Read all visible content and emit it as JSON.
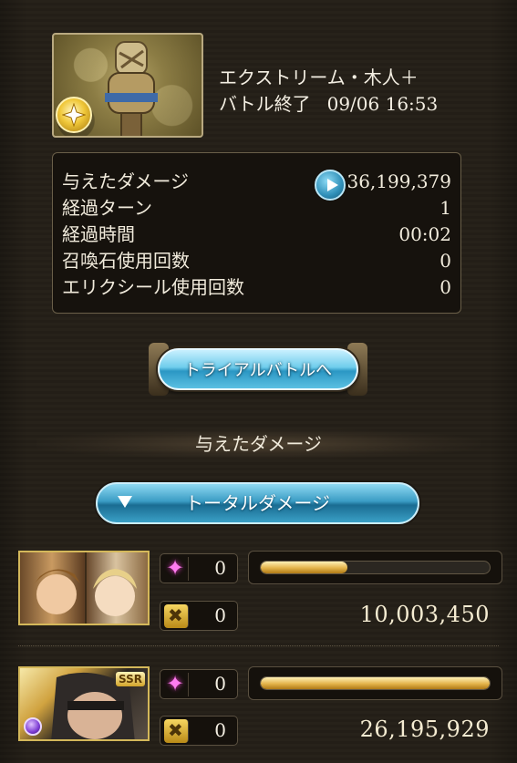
{
  "boss": {
    "name": "エクストリーム・木人＋",
    "status": "バトル終了",
    "datetime": "09/06 16:53",
    "element_icon": "wind-element-icon"
  },
  "stats": {
    "rows": [
      {
        "label": "与えたダメージ",
        "value": "36,199,379"
      },
      {
        "label": "経過ターン",
        "value": "1"
      },
      {
        "label": "経過時間",
        "value": "00:02"
      },
      {
        "label": "召喚石使用回数",
        "value": "0"
      },
      {
        "label": "エリクシール使用回数",
        "value": "0"
      }
    ]
  },
  "trial_button": {
    "label": "トライアルバトルへ"
  },
  "damage_section": {
    "title": "与えたダメージ",
    "dropdown_label": "トータルダメージ"
  },
  "party": [
    {
      "portrait": "character-pair-portrait",
      "ca_count": "0",
      "chain_count": "0",
      "damage": "10,003,450",
      "damage_ratio": 0.38
    },
    {
      "portrait": "character-portrait-ssr",
      "rarity": "SSR",
      "ca_count": "0",
      "chain_count": "0",
      "damage": "26,195,929",
      "damage_ratio": 1.0
    }
  ],
  "colors": {
    "accent_blue": "#3a9cc4",
    "gold": "#e3b34a",
    "background": "#252018"
  }
}
